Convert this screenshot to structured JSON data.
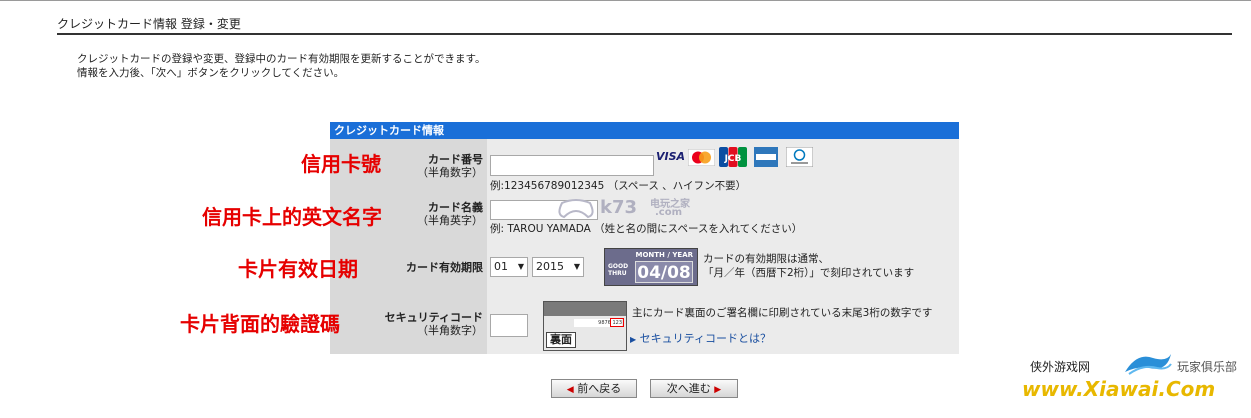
{
  "page": {
    "title": "クレジットカード情報 登録・変更",
    "intro_line1": "クレジットカードの登録や変更、登録中のカード有効期限を更新することができます。",
    "intro_line2": "情報を入力後、「次へ」ボタンをクリックしてください。"
  },
  "panel": {
    "header": "クレジットカード情報"
  },
  "annotations": {
    "card_number": "信用卡號",
    "card_name": "信用卡上的英文名字",
    "expiry": "卡片有效日期",
    "security": "卡片背面的驗證碼"
  },
  "fields": {
    "card_number": {
      "label": "カード番号",
      "sub": "（半角数字）",
      "value": "",
      "example": "例:123456789012345 （スペース 、ハイフン不要）"
    },
    "card_name": {
      "label": "カード名義",
      "sub": "（半角英字）",
      "value": "",
      "example": "例: TAROU YAMADA （姓と名の間にスペースを入れてください）"
    },
    "expiry": {
      "label": "カード有効期限",
      "month": "01",
      "year": "2015",
      "badge_header": "MONTH / YEAR",
      "badge_good": "GOOD THRU",
      "badge_value": "04/08",
      "note_line1": "カードの有効期限は通常、",
      "note_line2": "「月／年（西暦下2桁）」で刻印されています"
    },
    "security": {
      "label": "セキュリティコード",
      "sub": "（半角数字）",
      "value": "",
      "card_back_label": "裏面",
      "card_digits": "9876 123",
      "note": "主にカード裏面のご署名欄に印刷されている末尾3桁の数字です",
      "link": "セキュリティコードとは？"
    }
  },
  "card_brands": [
    {
      "name": "VISA",
      "icon": "visa-icon"
    },
    {
      "name": "MasterCard",
      "icon": "mastercard-icon"
    },
    {
      "name": "JCB",
      "icon": "jcb-icon"
    },
    {
      "name": "AMERICAN EXPRESS",
      "icon": "amex-icon"
    },
    {
      "name": "Diners Club",
      "icon": "diners-icon"
    }
  ],
  "buttons": {
    "back": "前へ戻る",
    "next": "次へ進む"
  },
  "watermarks": {
    "k73": "k73",
    "k73_cn": "电玩之家",
    "k73_url": ".com",
    "xiawai_cn1": "侠外游戏网",
    "xiawai_cn2": "玩家俱乐部",
    "xiawai_url": "www.Xiawai.Com"
  },
  "colors": {
    "header_blue": "#1a6fd8",
    "annotation_red": "#e60000",
    "panel_gray": "#ebebeb"
  }
}
